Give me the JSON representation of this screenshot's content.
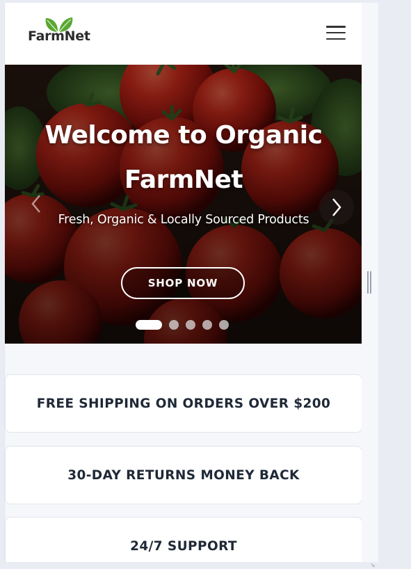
{
  "brand": {
    "name": "FarmNet"
  },
  "header": {
    "menu_icon": "hamburger-icon"
  },
  "hero": {
    "title_line1": "Welcome to Organic",
    "title_line2": "FarmNet",
    "subtitle": "Fresh, Organic & Locally Sourced Products",
    "cta_label": "SHOP NOW",
    "slide_count": 5,
    "active_slide": 1,
    "image": "fresh-tomatoes-photo"
  },
  "features": [
    {
      "label": "FREE SHIPPING ON ORDERS OVER $200"
    },
    {
      "label": "30-DAY RETURNS MONEY BACK"
    },
    {
      "label": "24/7 SUPPORT"
    }
  ],
  "colors": {
    "brand_green": "#5aa832",
    "text_dark": "#1f2937",
    "tomato_red": "#c8231b"
  }
}
